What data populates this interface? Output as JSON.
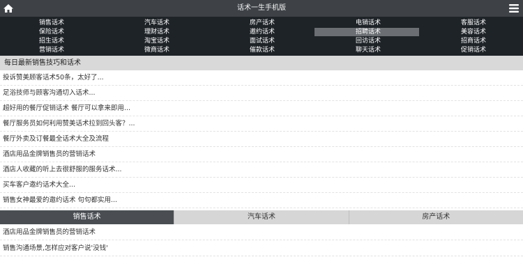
{
  "header": {
    "title": "话术一生手机版",
    "home_icon": "home-icon",
    "menu_icon": "hamburger-menu-icon"
  },
  "categories": {
    "row1": [
      "销售话术",
      "汽车话术",
      "房产话术",
      "电销话术",
      "客服话术"
    ],
    "row2": [
      "保险话术",
      "理财话术",
      "邀约话术",
      "招聘话术",
      "美容话术"
    ],
    "row3": [
      "招生话术",
      "淘宝话术",
      "面试话术",
      "回访话术",
      "招商话术"
    ],
    "row4": [
      "营销话术",
      "微商话术",
      "催款话术",
      "聊天话术",
      "促销话术"
    ],
    "active": "招聘话术"
  },
  "section": {
    "title": "每日最新销售技巧和话术"
  },
  "articles": [
    "投诉赞美顾客话术50条，太好了...",
    "足浴技师与顾客沟通切入话术...",
    "超好用的餐厅促销话术 餐厅可以拿来即用...",
    "餐厅服务员如何利用赞美话术拉到回头客？...",
    "餐厅外卖及订餐最全话术大全及流程",
    "酒店用品金牌销售员的营销话术",
    "酒店人收藏的听上去很舒服的服务话术...",
    "买车客户邀约话术大全...",
    "销售女神最爱的邀约话术 句句都实用..."
  ],
  "tabs": {
    "items": [
      "销售话术",
      "汽车话术",
      "房产话术"
    ],
    "active_index": 0
  },
  "tab_articles": [
    "酒店用品金牌销售员的营销话术",
    "销售沟通场景,怎样应对客户说'没钱'"
  ],
  "colors": {
    "topbar": "#3e4247",
    "nav_bg": "#1e2328",
    "active_cat": "#6b6f73",
    "section_bg": "#d9d9d9",
    "active_tab": "#4a4e53"
  }
}
